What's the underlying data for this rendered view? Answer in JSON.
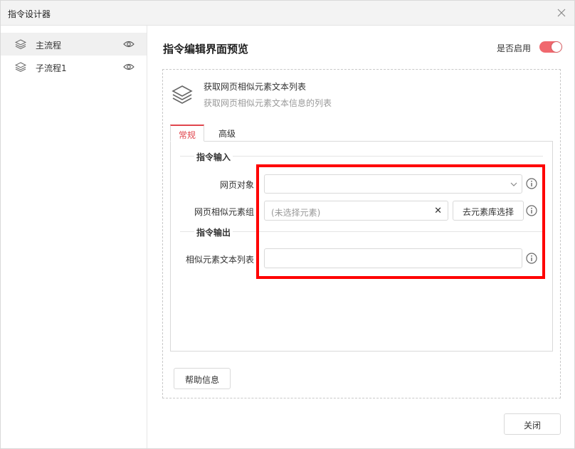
{
  "window": {
    "title": "指令设计器"
  },
  "sidebar": {
    "items": [
      {
        "label": "主流程"
      },
      {
        "label": "子流程1"
      }
    ]
  },
  "header": {
    "title": "指令编辑界面预览",
    "enable_label": "是否启用",
    "enabled": true
  },
  "command": {
    "name": "获取网页相似元素文本列表",
    "description": "获取网页相似元素文本信息的列表"
  },
  "tabs": [
    {
      "label": "常规",
      "active": true
    },
    {
      "label": "高级",
      "active": false
    }
  ],
  "sections": {
    "input_title": "指令输入",
    "output_title": "指令输出"
  },
  "fields": {
    "web_object": {
      "label": "网页对象",
      "value": ""
    },
    "similar_group": {
      "label": "网页相似元素组",
      "placeholder": "(未选择元素)",
      "button": "去元素库选择"
    },
    "text_list": {
      "label": "相似元素文本列表",
      "value": ""
    }
  },
  "buttons": {
    "help": "帮助信息",
    "close": "关闭"
  },
  "colors": {
    "accent": "#e0454d",
    "toggle_on": "#f0686e",
    "highlight": "#ff0000"
  }
}
